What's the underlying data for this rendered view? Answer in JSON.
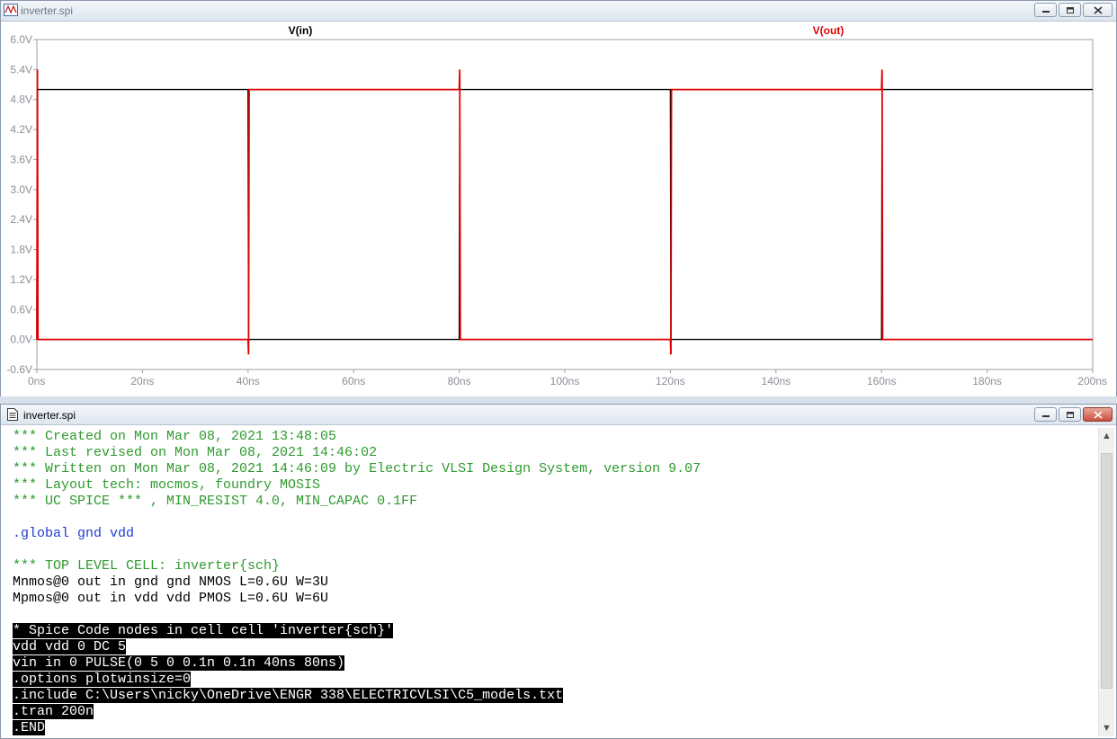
{
  "plot_window": {
    "title": "inverter.spi",
    "colors": {
      "vin": "#000000",
      "vout": "#e00000",
      "grid": "#c8c8c8",
      "axis_text": "#8a8f96"
    }
  },
  "editor_window": {
    "title": "inverter.spi",
    "lines": [
      {
        "text": "*** Created on Mon Mar 08, 2021 13:48:05",
        "style": "green"
      },
      {
        "text": "*** Last revised on Mon Mar 08, 2021 14:46:02",
        "style": "green"
      },
      {
        "text": "*** Written on Mon Mar 08, 2021 14:46:09 by Electric VLSI Design System, version 9.07",
        "style": "green"
      },
      {
        "text": "*** Layout tech: mocmos, foundry MOSIS",
        "style": "green"
      },
      {
        "text": "*** UC SPICE *** , MIN_RESIST 4.0, MIN_CAPAC 0.1FF",
        "style": "green"
      },
      {
        "text": "",
        "style": "black"
      },
      {
        "text": ".global gnd vdd",
        "style": "blue"
      },
      {
        "text": "",
        "style": "black"
      },
      {
        "text": "*** TOP LEVEL CELL: inverter{sch}",
        "style": "green"
      },
      {
        "text": "Mnmos@0 out in gnd gnd NMOS L=0.6U W=3U",
        "style": "black"
      },
      {
        "text": "Mpmos@0 out in vdd vdd PMOS L=0.6U W=6U",
        "style": "black"
      },
      {
        "text": "",
        "style": "black"
      },
      {
        "text": "* Spice Code nodes in cell cell 'inverter{sch}'",
        "style": "selected"
      },
      {
        "text": "vdd vdd 0 DC 5",
        "style": "selected"
      },
      {
        "text": "vin in 0 PULSE(0 5 0 0.1n 0.1n 40ns 80ns)",
        "style": "selected"
      },
      {
        "text": ".options plotwinsize=0",
        "style": "selected"
      },
      {
        "text": ".include C:\\Users\\nicky\\OneDrive\\ENGR 338\\ELECTRICVLSI\\C5_models.txt",
        "style": "selected"
      },
      {
        "text": ".tran 200n",
        "style": "selected"
      },
      {
        "text": ".END",
        "style": "selected"
      }
    ]
  },
  "chart_data": {
    "type": "line",
    "x_unit": "ns",
    "y_unit": "V",
    "xlim": [
      0,
      200
    ],
    "ylim": [
      -0.6,
      6.0
    ],
    "x_ticks": [
      "0ns",
      "20ns",
      "40ns",
      "60ns",
      "80ns",
      "100ns",
      "120ns",
      "140ns",
      "160ns",
      "180ns",
      "200ns"
    ],
    "y_ticks": [
      "6.0V",
      "5.4V",
      "4.8V",
      "4.2V",
      "3.6V",
      "3.0V",
      "2.4V",
      "1.8V",
      "1.2V",
      "0.6V",
      "0.0V",
      "-0.6V"
    ],
    "grid": true,
    "series": [
      {
        "name": "V(in)",
        "color": "#000000",
        "x": [
          0,
          0.1,
          40,
          40.1,
          80,
          80.1,
          120,
          120.1,
          160,
          160.1,
          200
        ],
        "y": [
          0,
          5,
          5,
          0,
          0,
          5,
          5,
          0,
          0,
          5,
          5
        ]
      },
      {
        "name": "V(out)",
        "color": "#e00000",
        "x": [
          0,
          0.1,
          0.2,
          40,
          40.1,
          40.2,
          80,
          80.1,
          80.2,
          120,
          120.1,
          120.2,
          160,
          160.1,
          160.2,
          200
        ],
        "y": [
          0,
          5.4,
          0,
          0,
          -0.3,
          5,
          5,
          5.4,
          0,
          0,
          -0.3,
          5,
          5,
          5.4,
          0,
          0
        ]
      }
    ]
  }
}
